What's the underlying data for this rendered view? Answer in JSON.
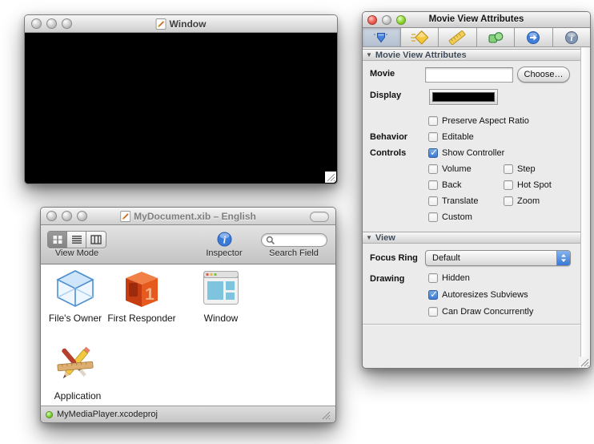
{
  "window_a": {
    "title": "Window"
  },
  "window_b": {
    "title": "MyDocument.xib – English",
    "toolbar": {
      "view_mode": "View Mode",
      "inspector": "Inspector",
      "search_field": "Search Field"
    },
    "items": [
      {
        "label": "File's Owner"
      },
      {
        "label": "First Responder"
      },
      {
        "label": "Window"
      },
      {
        "label": "Application"
      }
    ],
    "status": "MyMediaPlayer.xcodeproj"
  },
  "inspector": {
    "title": "Movie View Attributes",
    "tabs": [
      {
        "name": "attributes",
        "selected": true
      },
      {
        "name": "effects",
        "selected": false
      },
      {
        "name": "size",
        "selected": false
      },
      {
        "name": "connections",
        "selected": false
      },
      {
        "name": "bindings",
        "selected": false
      },
      {
        "name": "identity",
        "selected": false
      }
    ],
    "section_movie": {
      "title": "Movie View Attributes"
    },
    "movie_label": "Movie",
    "movie_value": "",
    "choose_button": "Choose…",
    "display_label": "Display",
    "behavior_label": "Behavior",
    "controls_label": "Controls",
    "checks": [
      {
        "label": "Preserve Aspect Ratio",
        "checked": false
      },
      {
        "label": "Editable",
        "checked": false
      },
      {
        "label": "Show Controller",
        "checked": true
      },
      {
        "label": "Volume",
        "checked": false
      },
      {
        "label": "Step",
        "checked": false
      },
      {
        "label": "Back",
        "checked": false
      },
      {
        "label": "Hot Spot",
        "checked": false
      },
      {
        "label": "Translate",
        "checked": false
      },
      {
        "label": "Zoom",
        "checked": false
      },
      {
        "label": "Custom",
        "checked": false
      },
      {
        "label": "Hidden",
        "checked": false
      },
      {
        "label": "Autoresizes Subviews",
        "checked": true
      },
      {
        "label": "Can Draw Concurrently",
        "checked": false
      }
    ],
    "section_view": {
      "title": "View"
    },
    "focus_ring_label": "Focus Ring",
    "focus_ring_value": "Default",
    "drawing_label": "Drawing"
  },
  "colors": {
    "accent_blue": "#3d7fd6",
    "selected_tab": "#bcc8d6",
    "status_green": "#6cc644",
    "checked_blue": "#4585d5"
  }
}
